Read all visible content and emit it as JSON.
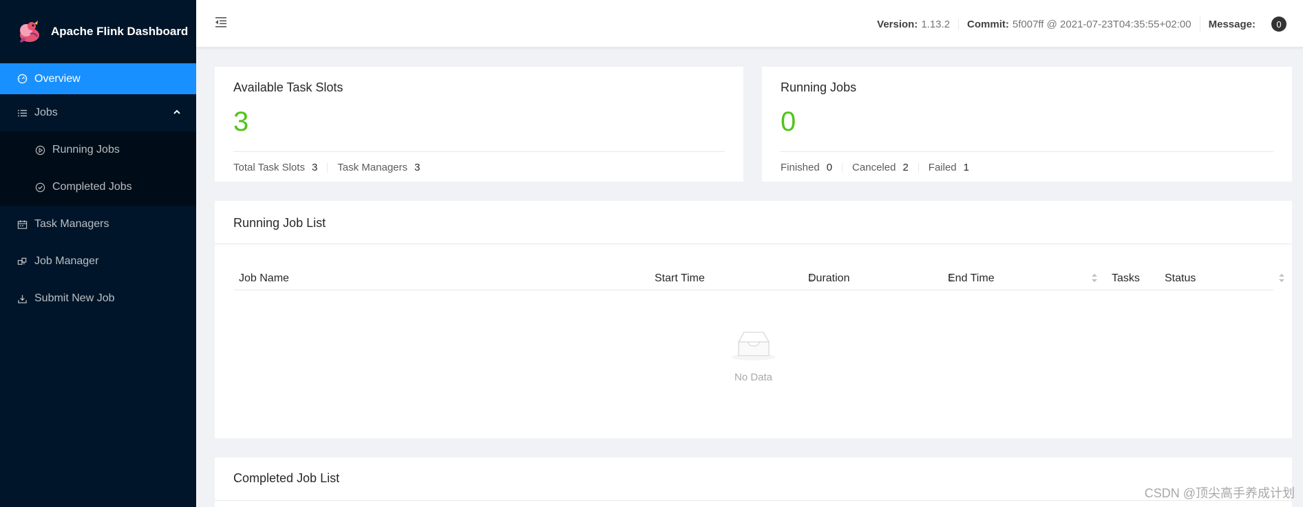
{
  "app": {
    "title": "Apache Flink Dashboard"
  },
  "sidebar": {
    "items": [
      {
        "label": "Overview",
        "icon": "dashboard-icon",
        "active": true
      },
      {
        "label": "Jobs",
        "icon": "list-icon",
        "expanded": true
      },
      {
        "label": "Running Jobs",
        "icon": "play-circle-icon",
        "sub": true
      },
      {
        "label": "Completed Jobs",
        "icon": "check-circle-icon",
        "sub": true
      },
      {
        "label": "Task Managers",
        "icon": "schedule-icon"
      },
      {
        "label": "Job Manager",
        "icon": "build-icon"
      },
      {
        "label": "Submit New Job",
        "icon": "upload-icon"
      }
    ]
  },
  "header": {
    "version_label": "Version:",
    "version_value": "1.13.2",
    "commit_label": "Commit:",
    "commit_value": "5f007ff @ 2021-07-23T04:35:55+02:00",
    "message_label": "Message:",
    "message_count": "0"
  },
  "slots_card": {
    "title": "Available Task Slots",
    "value": "3",
    "total_label": "Total Task Slots",
    "total_value": "3",
    "tm_label": "Task Managers",
    "tm_value": "3"
  },
  "jobs_card": {
    "title": "Running Jobs",
    "value": "0",
    "finished_label": "Finished",
    "finished_value": "0",
    "canceled_label": "Canceled",
    "canceled_value": "2",
    "failed_label": "Failed",
    "failed_value": "1"
  },
  "running_list": {
    "title": "Running Job List",
    "columns": [
      "Job Name",
      "Start Time",
      "Duration",
      "End Time",
      "Tasks",
      "Status"
    ],
    "empty_text": "No Data"
  },
  "completed_list": {
    "title": "Completed Job List"
  },
  "watermark": "CSDN @顶尖高手养成计划",
  "colors": {
    "sidebar_bg": "#001529",
    "accent": "#1890ff",
    "success": "#52c41a"
  }
}
